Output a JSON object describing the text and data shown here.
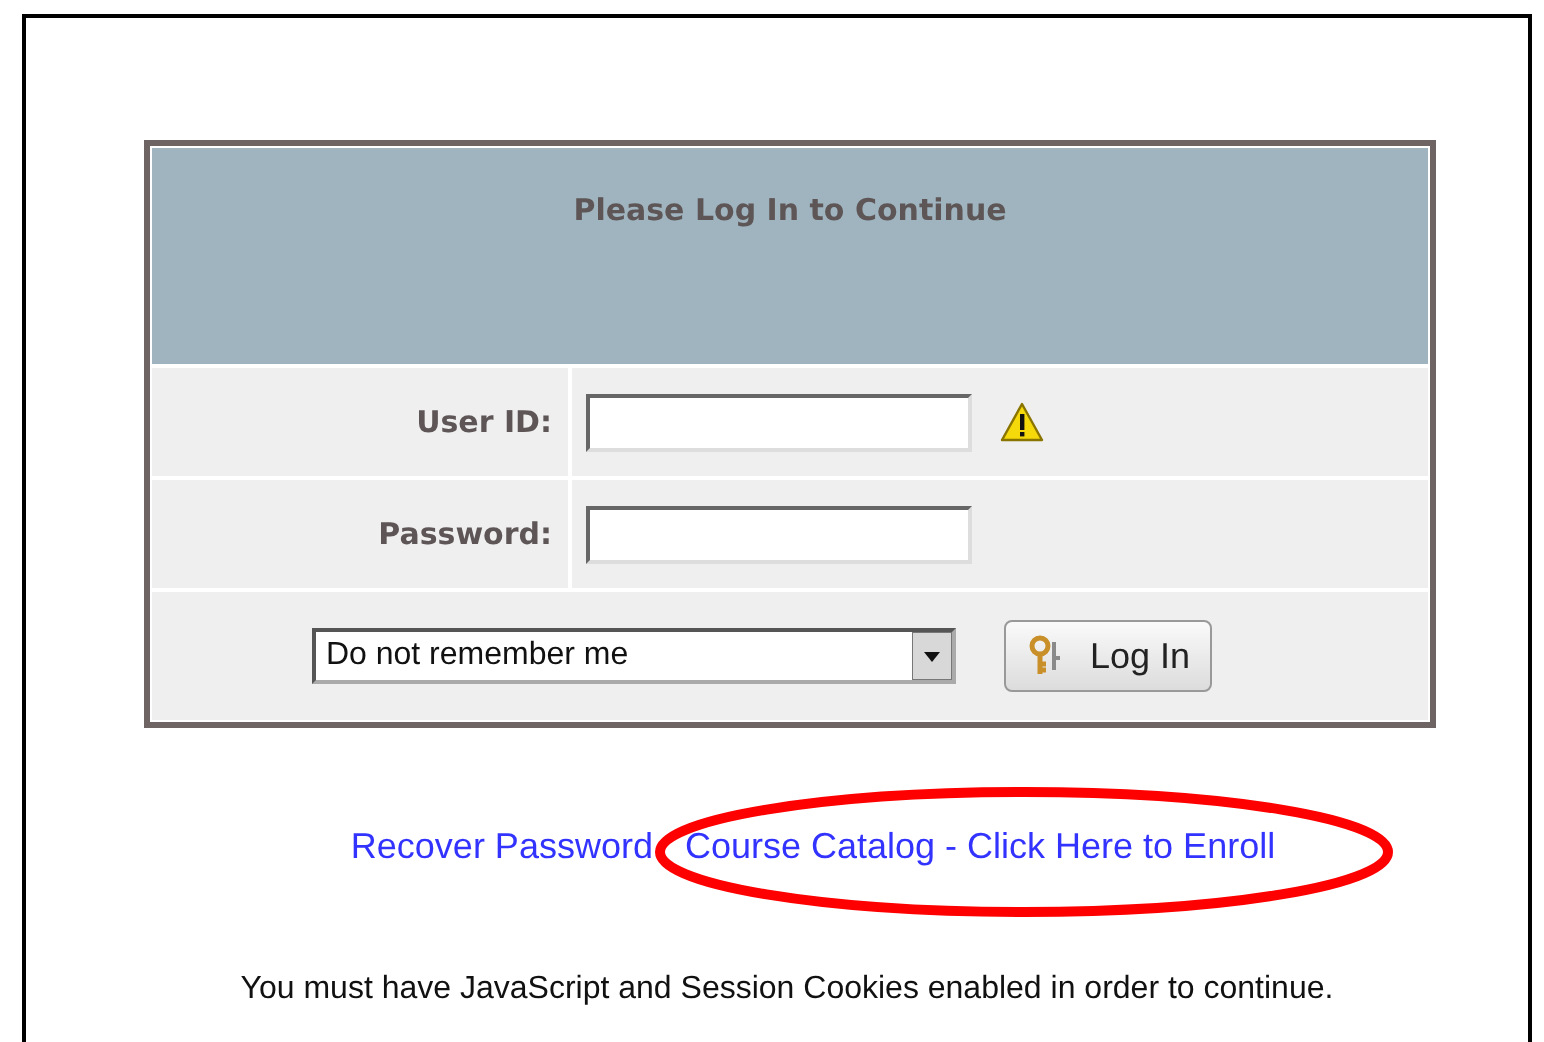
{
  "panel": {
    "title": "Please Log In to Continue",
    "fields": [
      {
        "label": "User ID:",
        "warning": true
      },
      {
        "label": "Password:",
        "warning": false
      }
    ],
    "remember_select": {
      "value": "Do not remember me"
    },
    "login_button": {
      "label": "Log In"
    }
  },
  "links": [
    {
      "label": "Recover Password",
      "circled": false
    },
    {
      "label": "Course Catalog - Click Here to Enroll",
      "circled": true
    }
  ],
  "note": "You must have JavaScript and Session Cookies enabled in order to continue."
}
